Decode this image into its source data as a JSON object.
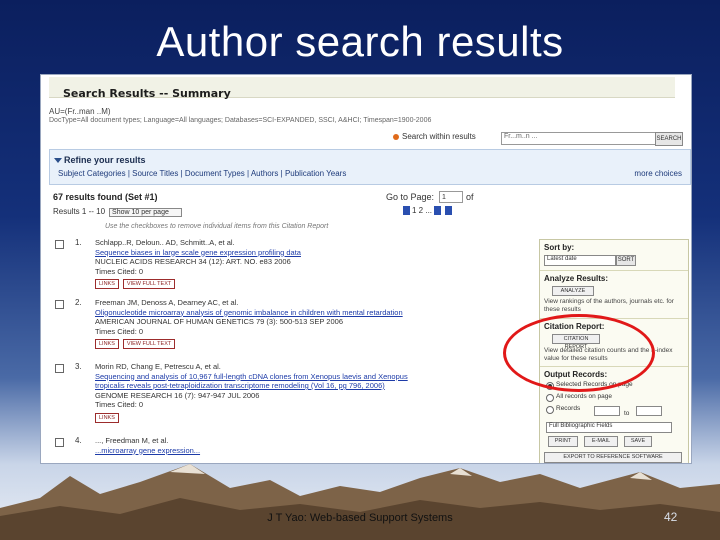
{
  "slide": {
    "title": "Author search results",
    "footer": "J T Yao: Web-based Support Systems",
    "page_number": "42"
  },
  "screenshot": {
    "header_title": "Search Results -- Summary",
    "query_line1": "AU=(Fr..man ..M)",
    "query_line2": "DocType=All document types; Language=All languages; Databases=SCI-EXPANDED, SSCI, A&HCI; Timespan=1900-2006",
    "search_within_label": "Search within results",
    "search_within_value": "Fr...m..n ...",
    "search_button": "SEARCH",
    "refine_title": "Refine your results",
    "refine_links": "Subject Categories | Source Titles | Document Types | Authors | Publication Years",
    "more_choices": "more choices",
    "results_found": "67 results found (Set #1)",
    "goto_label": "Go to Page:",
    "goto_value": "1",
    "of_label": "of",
    "pager": "1  2  ...",
    "showing": "Results 1 -- 10",
    "show_select": "Show 10 per page",
    "info": "Use the checkboxes to remove individual items from this Citation Report",
    "records": [
      {
        "num": "1.",
        "authors": "Schlapp..R, Deloun.. AD, Schmitt..A, et al.",
        "title": "Sequence biases in large scale gene expression profiling data",
        "source": "NUCLEIC ACIDS RESEARCH 34 (12): ART. NO. e83 2006",
        "cited": "Times Cited: 0",
        "links": "LINKS",
        "fulltext": "VIEW FULL TEXT"
      },
      {
        "num": "2.",
        "authors": "Freeman JM, Denoss A, Dearney AC, et al.",
        "title": "Oligonucleotide microarray analysis of genomic imbalance in children with mental retardation",
        "source": "AMERICAN JOURNAL OF HUMAN GENETICS 79 (3): 500-513 SEP 2006",
        "cited": "Times Cited: 0",
        "links": "LINKS",
        "fulltext": "VIEW FULL TEXT"
      },
      {
        "num": "3.",
        "authors": "Morin RD, Chang E, Petrescu A, et al.",
        "title": "Sequencing and analysis of 10,967 full-length cDNA clones from Xenopus laevis and Xenopus",
        "title2": "tropicalis reveals post-tetraploidization transcriptome remodeling (Vol 16, pg 796, 2006)",
        "source": "GENOME RESEARCH 16 (7): 947-947 JUL 2006",
        "cited": "Times Cited: 0",
        "links": "LINKS"
      },
      {
        "num": "4.",
        "authors": "..., Freedman M, et al.",
        "title": "...microarray gene expression..."
      }
    ],
    "sidebar": {
      "sort_by": "Sort by:",
      "sort_value": "Latest date",
      "sort_go": "SORT",
      "analyze_title": "Analyze Results:",
      "analyze_button": "ANALYZE",
      "analyze_text": "View rankings of the authors, journals etc. for these results",
      "citation_title": "Citation Report:",
      "citation_button": "CITATION REPORT",
      "citation_text": "View detailed citation counts and the h-index value for these results",
      "output_title": "Output Records:",
      "opt_selected": "Selected Records on page",
      "opt_all": "All records on page",
      "opt_records": "Records",
      "to": "to",
      "pub_select": "Full Bibliographic Fields",
      "print": "PRINT",
      "email": "E-MAIL",
      "save": "SAVE",
      "export": "EXPORT TO REFERENCE SOFTWARE"
    }
  },
  "colors": {
    "highlight_circle": "#e11818",
    "link": "#1d3ba8"
  }
}
